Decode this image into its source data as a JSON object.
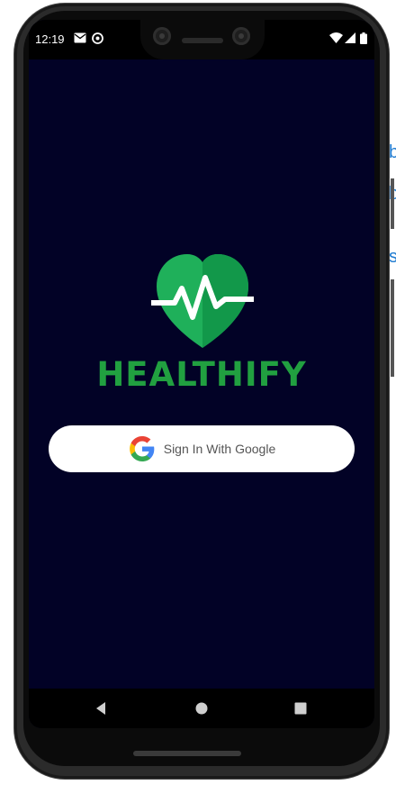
{
  "status_bar": {
    "time": "12:19",
    "left_icons": [
      "mail-icon",
      "sync-icon"
    ],
    "right_icons": [
      "wifi-icon",
      "signal-icon",
      "battery-icon"
    ]
  },
  "app": {
    "name": "HEALTHIFY",
    "logo_icon": "heart-pulse-icon",
    "brand_color": "#21A040",
    "background_color": "#020226"
  },
  "sign_in": {
    "label": "Sign In With Google",
    "icon": "google-icon"
  },
  "nav_bar": {
    "buttons": [
      "back-icon",
      "home-icon",
      "recents-icon"
    ]
  },
  "colors": {
    "button_background": "#FFFFFF",
    "status_bar": "#000000"
  }
}
